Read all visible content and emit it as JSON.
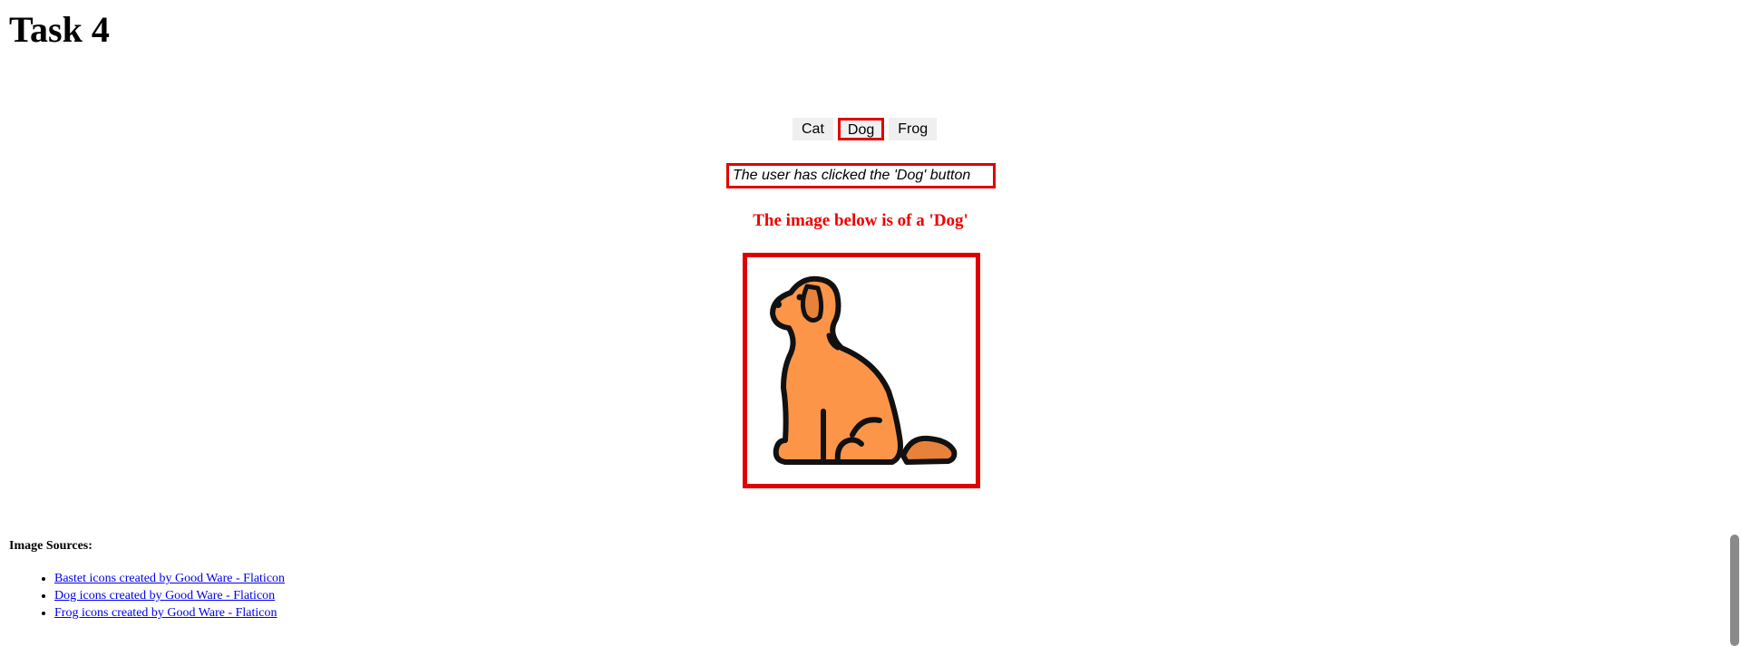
{
  "page": {
    "title": "Task 4"
  },
  "buttons": [
    {
      "label": "Cat",
      "selected": false
    },
    {
      "label": "Dog",
      "selected": true
    },
    {
      "label": "Frog",
      "selected": false
    }
  ],
  "status": {
    "text": "The user has clicked the 'Dog' button"
  },
  "image": {
    "caption": "The image below is of a 'Dog'",
    "icon": "dog-icon"
  },
  "sources": {
    "title": "Image Sources:",
    "links": [
      "Bastet icons created by Good Ware - Flaticon",
      "Dog icons created by Good Ware - Flaticon",
      "Frog icons created by Good Ware - Flaticon"
    ]
  },
  "colors": {
    "highlight": "#e00000",
    "dog_fill": "#fd9548",
    "link": "#0000ee"
  }
}
